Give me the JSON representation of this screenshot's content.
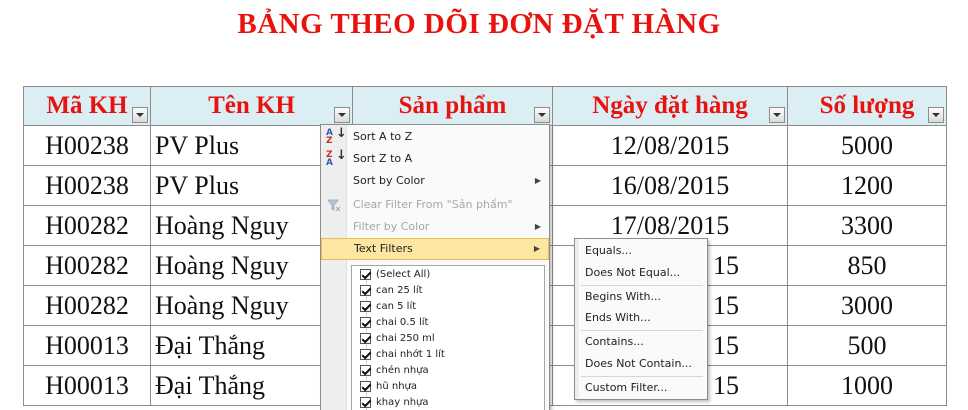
{
  "title": "BẢNG THEO DÕI ĐƠN ĐẶT HÀNG",
  "headers": [
    "Mã KH",
    "Tên KH",
    "Sản phẩm",
    "Ngày đặt hàng",
    "Số lượng"
  ],
  "rows": [
    [
      "H00238",
      "PV Plus",
      "",
      "12/08/2015",
      "5000"
    ],
    [
      "H00238",
      "PV Plus",
      "",
      "16/08/2015",
      "1200"
    ],
    [
      "H00282",
      "Hoàng Nguy",
      "",
      "17/08/2015",
      "3300"
    ],
    [
      "H00282",
      "Hoàng Nguy",
      "",
      "15",
      "850"
    ],
    [
      "H00282",
      "Hoàng Nguy",
      "",
      "15",
      "3000"
    ],
    [
      "H00013",
      "Đại Thắng",
      "",
      "15",
      "500"
    ],
    [
      "H00013",
      "Đại Thắng",
      "",
      "15",
      "1000"
    ]
  ],
  "filter_menu": {
    "sort_az": "Sort A to Z",
    "sort_za": "Sort Z to A",
    "sort_by_color": "Sort by Color",
    "clear_filter": "Clear Filter From \"Sản phẩm\"",
    "filter_by_color": "Filter by Color",
    "text_filters": "Text Filters",
    "values": [
      {
        "label": "(Select All)",
        "checked": true
      },
      {
        "label": "can 25 lít",
        "checked": true
      },
      {
        "label": "can 5 lít",
        "checked": true
      },
      {
        "label": "chai 0.5 lít",
        "checked": true
      },
      {
        "label": "chai 250 ml",
        "checked": true
      },
      {
        "label": "chai nhớt 1 lít",
        "checked": true
      },
      {
        "label": "chén nhựa",
        "checked": true
      },
      {
        "label": "hũ nhựa",
        "checked": true
      },
      {
        "label": "khay nhựa",
        "checked": true
      }
    ]
  },
  "text_filters_submenu": [
    "Equals...",
    "Does Not Equal...",
    "Begins With...",
    "Ends With...",
    "Contains...",
    "Does Not Contain...",
    "Custom Filter..."
  ],
  "colors": {
    "title_red": "#e8130f",
    "header_bg": "#dbeef4",
    "menu_highlight": "#fde6a1"
  }
}
